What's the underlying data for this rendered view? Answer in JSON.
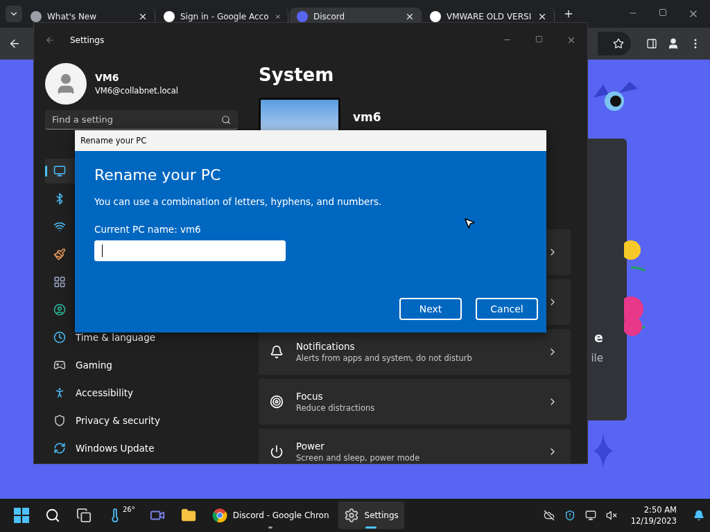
{
  "browser": {
    "tabs": [
      {
        "title": "What's New",
        "selected": false
      },
      {
        "title": "Sign in - Google Acco",
        "selected": false
      },
      {
        "title": "Discord",
        "selected": true
      },
      {
        "title": "VMWARE OLD VERSI",
        "selected": false
      }
    ]
  },
  "page": {
    "card_texts": [
      "e",
      "ile"
    ]
  },
  "settings": {
    "title": "Settings",
    "user": {
      "name": "VM6",
      "email": "VM6@collabnet.local"
    },
    "search": {
      "placeholder": "Find a setting"
    },
    "nav": [
      {
        "selected": true
      },
      {
        "selected": false
      },
      {
        "selected": false
      },
      {
        "selected": false
      },
      {
        "selected": false
      },
      {
        "selected": false
      },
      {
        "label": "Time & language",
        "selected": false
      },
      {
        "label": "Gaming",
        "selected": false
      },
      {
        "label": "Accessibility",
        "selected": false
      },
      {
        "label": "Privacy & security",
        "selected": false
      },
      {
        "label": "Windows Update",
        "selected": false
      }
    ],
    "heading": "System",
    "device": {
      "name": "vm6"
    },
    "cards": [
      {
        "kind": "covered"
      },
      {
        "kind": "covered"
      },
      {
        "kind": "item",
        "title": "Notifications",
        "subtitle": "Alerts from apps and system, do not disturb"
      },
      {
        "kind": "item",
        "title": "Focus",
        "subtitle": "Reduce distractions"
      },
      {
        "kind": "item",
        "title": "Power",
        "subtitle": "Screen and sleep, power mode"
      }
    ]
  },
  "dialog": {
    "window_title": "Rename your PC",
    "heading": "Rename your PC",
    "description": "You can use a combination of letters, hyphens, and numbers.",
    "current_name": "Current PC name: vm6",
    "name_field": {
      "focused": true
    },
    "buttons": [
      "Next",
      "Cancel"
    ]
  },
  "taskbar": {
    "apps": [
      {
        "selected": false,
        "running": false
      },
      {
        "selected": false,
        "running": false
      },
      {
        "selected": false,
        "running": false
      },
      {
        "label": "26°",
        "selected": false,
        "running": false
      },
      {
        "selected": false,
        "running": false
      },
      {
        "selected": false,
        "running": false
      },
      {
        "label": "Discord - Google Chron",
        "selected": false,
        "running": true
      },
      {
        "label": "Settings",
        "selected": true,
        "running": true
      }
    ],
    "time": "2:50 AM",
    "date": "12/19/2023"
  }
}
